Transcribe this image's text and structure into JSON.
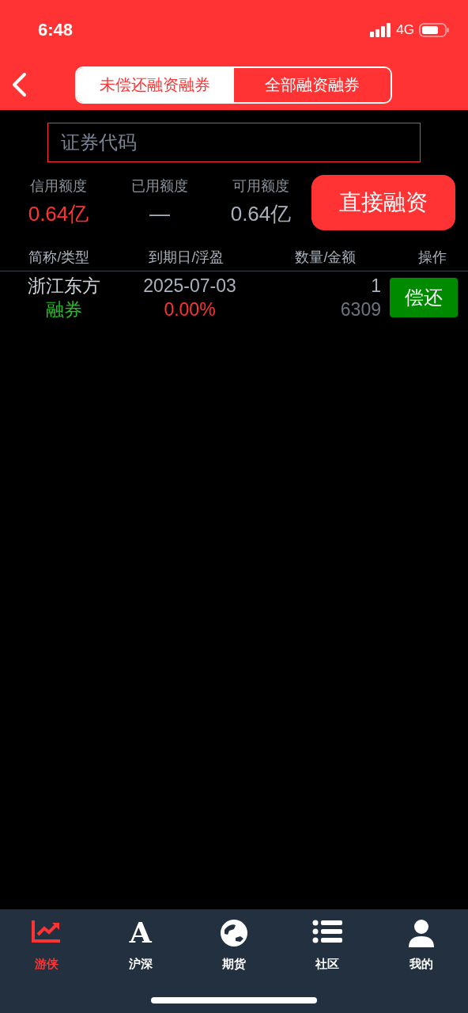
{
  "status_bar": {
    "time": "6:48",
    "network": "4G"
  },
  "header": {
    "tabs": [
      {
        "label": "未偿还融资融券",
        "selected": true
      },
      {
        "label": "全部融资融券",
        "selected": false
      }
    ]
  },
  "search": {
    "placeholder": "证券代码"
  },
  "stats": [
    {
      "label": "信用额度",
      "value": "0.64亿",
      "highlight": true
    },
    {
      "label": "已用额度",
      "value": "—",
      "highlight": false
    },
    {
      "label": "可用额度",
      "value": "0.64亿",
      "highlight": false
    }
  ],
  "action_button": "直接融资",
  "table": {
    "columns": [
      "简称/类型",
      "到期日/浮盈",
      "数量/金额",
      "操作"
    ],
    "rows": [
      {
        "name": "浙江东方",
        "type": "融券",
        "date": "2025-07-03",
        "profit": "0.00%",
        "quantity": "1",
        "amount": "6309",
        "button": "偿还"
      }
    ]
  },
  "nav": [
    {
      "label": "游侠",
      "kind": "chart",
      "selected": true
    },
    {
      "label": "沪深",
      "kind": "letter",
      "glyph": "A",
      "selected": false
    },
    {
      "label": "期货",
      "kind": "globe",
      "selected": false
    },
    {
      "label": "社区",
      "kind": "list",
      "selected": false
    },
    {
      "label": "我的",
      "kind": "person",
      "selected": false
    }
  ]
}
